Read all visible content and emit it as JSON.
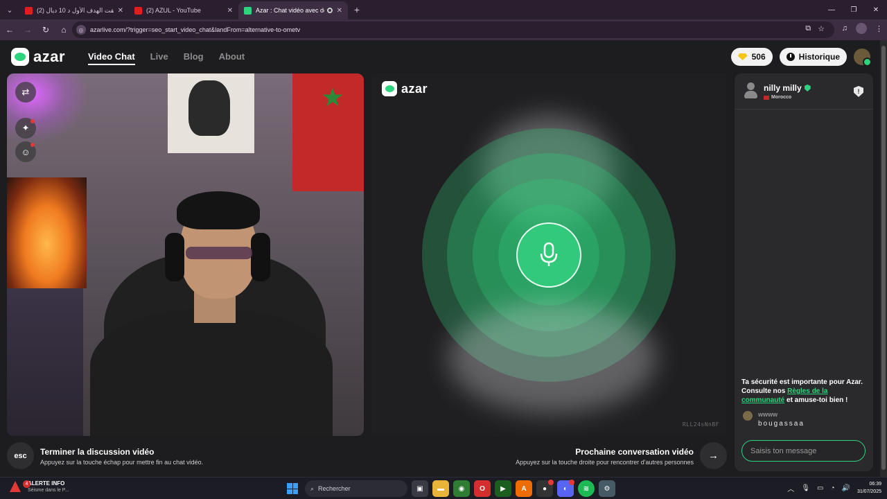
{
  "browser": {
    "tabs": [
      {
        "title": "(2) حققت الهدف الأول د 10 ديال",
        "favicon": "youtube-icon",
        "active": false
      },
      {
        "title": "(2) AZUL - YouTube",
        "favicon": "youtube-icon",
        "active": false
      },
      {
        "title": "Azar : Chat vidéo avec de n",
        "favicon": "azar-icon",
        "active": true
      }
    ],
    "url": "azarlive.com/?trigger=seo_start_video_chat&landFrom=alternative-to-ometv"
  },
  "header": {
    "logo_text": "azar",
    "nav": [
      {
        "label": "Video Chat",
        "active": true
      },
      {
        "label": "Live",
        "active": false
      },
      {
        "label": "Blog",
        "active": false
      },
      {
        "label": "About",
        "active": false
      }
    ],
    "gems": "506",
    "history_label": "Historique"
  },
  "peer_video": {
    "logo_text": "azar",
    "session_code": "RLL24sNnBF",
    "accent_color": "#2ed37e"
  },
  "chat": {
    "peer_name": "nilly milly",
    "peer_country": "Morocco",
    "safety_prefix": "Ta sécurité est importante pour Azar. Consulte nos ",
    "safety_link": "Règles de la communauté",
    "safety_suffix": " et amuse-toi bien !",
    "messages": [
      {
        "user": "wwww",
        "text": "bougassaa"
      }
    ],
    "input_placeholder": "Saisis ton message"
  },
  "bottom": {
    "esc_label": "esc",
    "end_title": "Terminer la discussion vidéo",
    "end_desc": "Appuyez sur la touche échap pour mettre fin au chat vidéo.",
    "next_title": "Prochaine conversation vidéo",
    "next_desc": "Appuyez sur la touche droite pour rencontrer d'autres personnes"
  },
  "taskbar": {
    "alert_count": "4",
    "alert_title": "ALERTE INFO",
    "alert_sub": "Séisme dans le P...",
    "search_label": "Rechercher",
    "time": "06:39",
    "date": "31/07/2025"
  }
}
